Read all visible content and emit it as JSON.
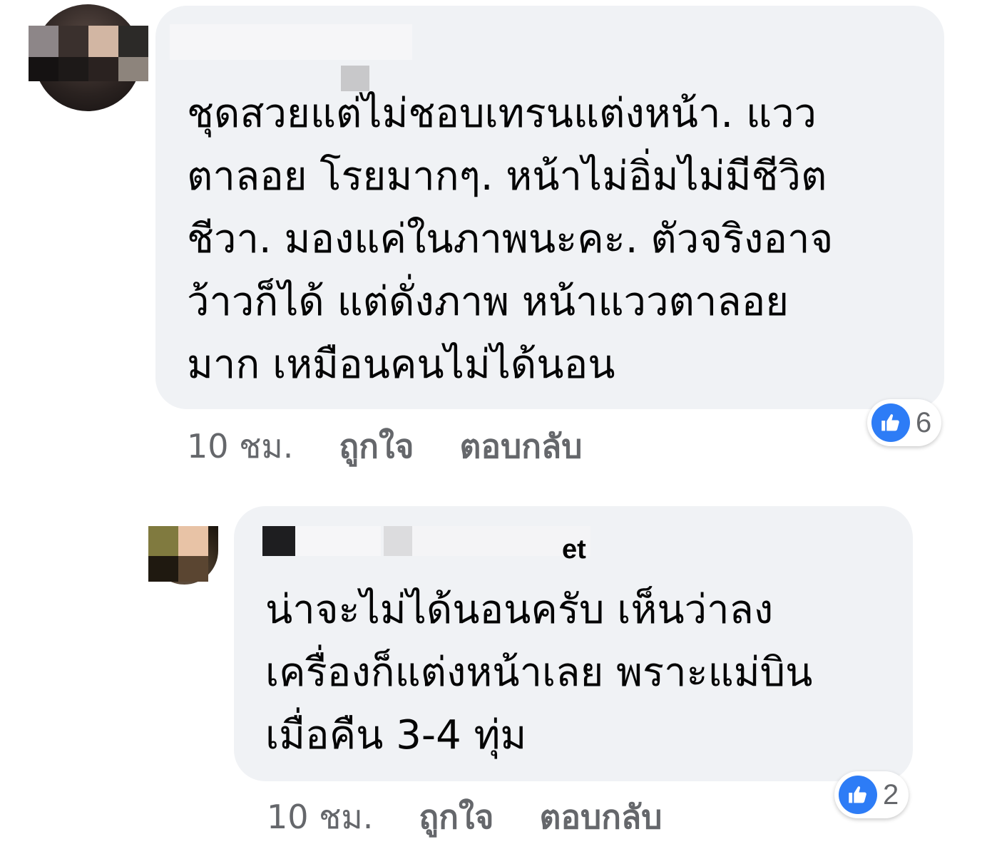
{
  "comments": [
    {
      "name_fragment": "",
      "text": "ชุดสวยแต่ไม่ชอบเทรนแต่งหน้า. แวว\nตาลอย โรยมากๆ. หน้าไม่อิ่มไม่มีชีวิต\nชีวา.  มองแค่ในภาพนะคะ. ตัวจริงอาจ\nว้าวก็ได้  แต่ดั่งภาพ หน้าแววตาลอย\nมาก เหมือนคนไม่ได้นอน",
      "reaction_count": "6",
      "time": "10 ชม.",
      "like_label": "ถูกใจ",
      "reply_label": "ตอบกลับ"
    },
    {
      "name_fragment": "et",
      "text": "น่าจะไม่ได้นอนครับ เห็นว่าลง\nเครื่องก็แต่งหน้าเลย พราะแม่บิน\nเมื่อคืน 3-4 ทุ่ม",
      "reaction_count": "2",
      "time": "10 ชม.",
      "like_label": "ถูกใจ",
      "reply_label": "ตอบกลับ"
    }
  ],
  "colors": {
    "bubble": "#f0f2f5",
    "text": "#050505",
    "meta": "#65676b",
    "like_blue": "#2d7cf6"
  },
  "icons": {
    "reaction": "thumbs-up-icon"
  }
}
